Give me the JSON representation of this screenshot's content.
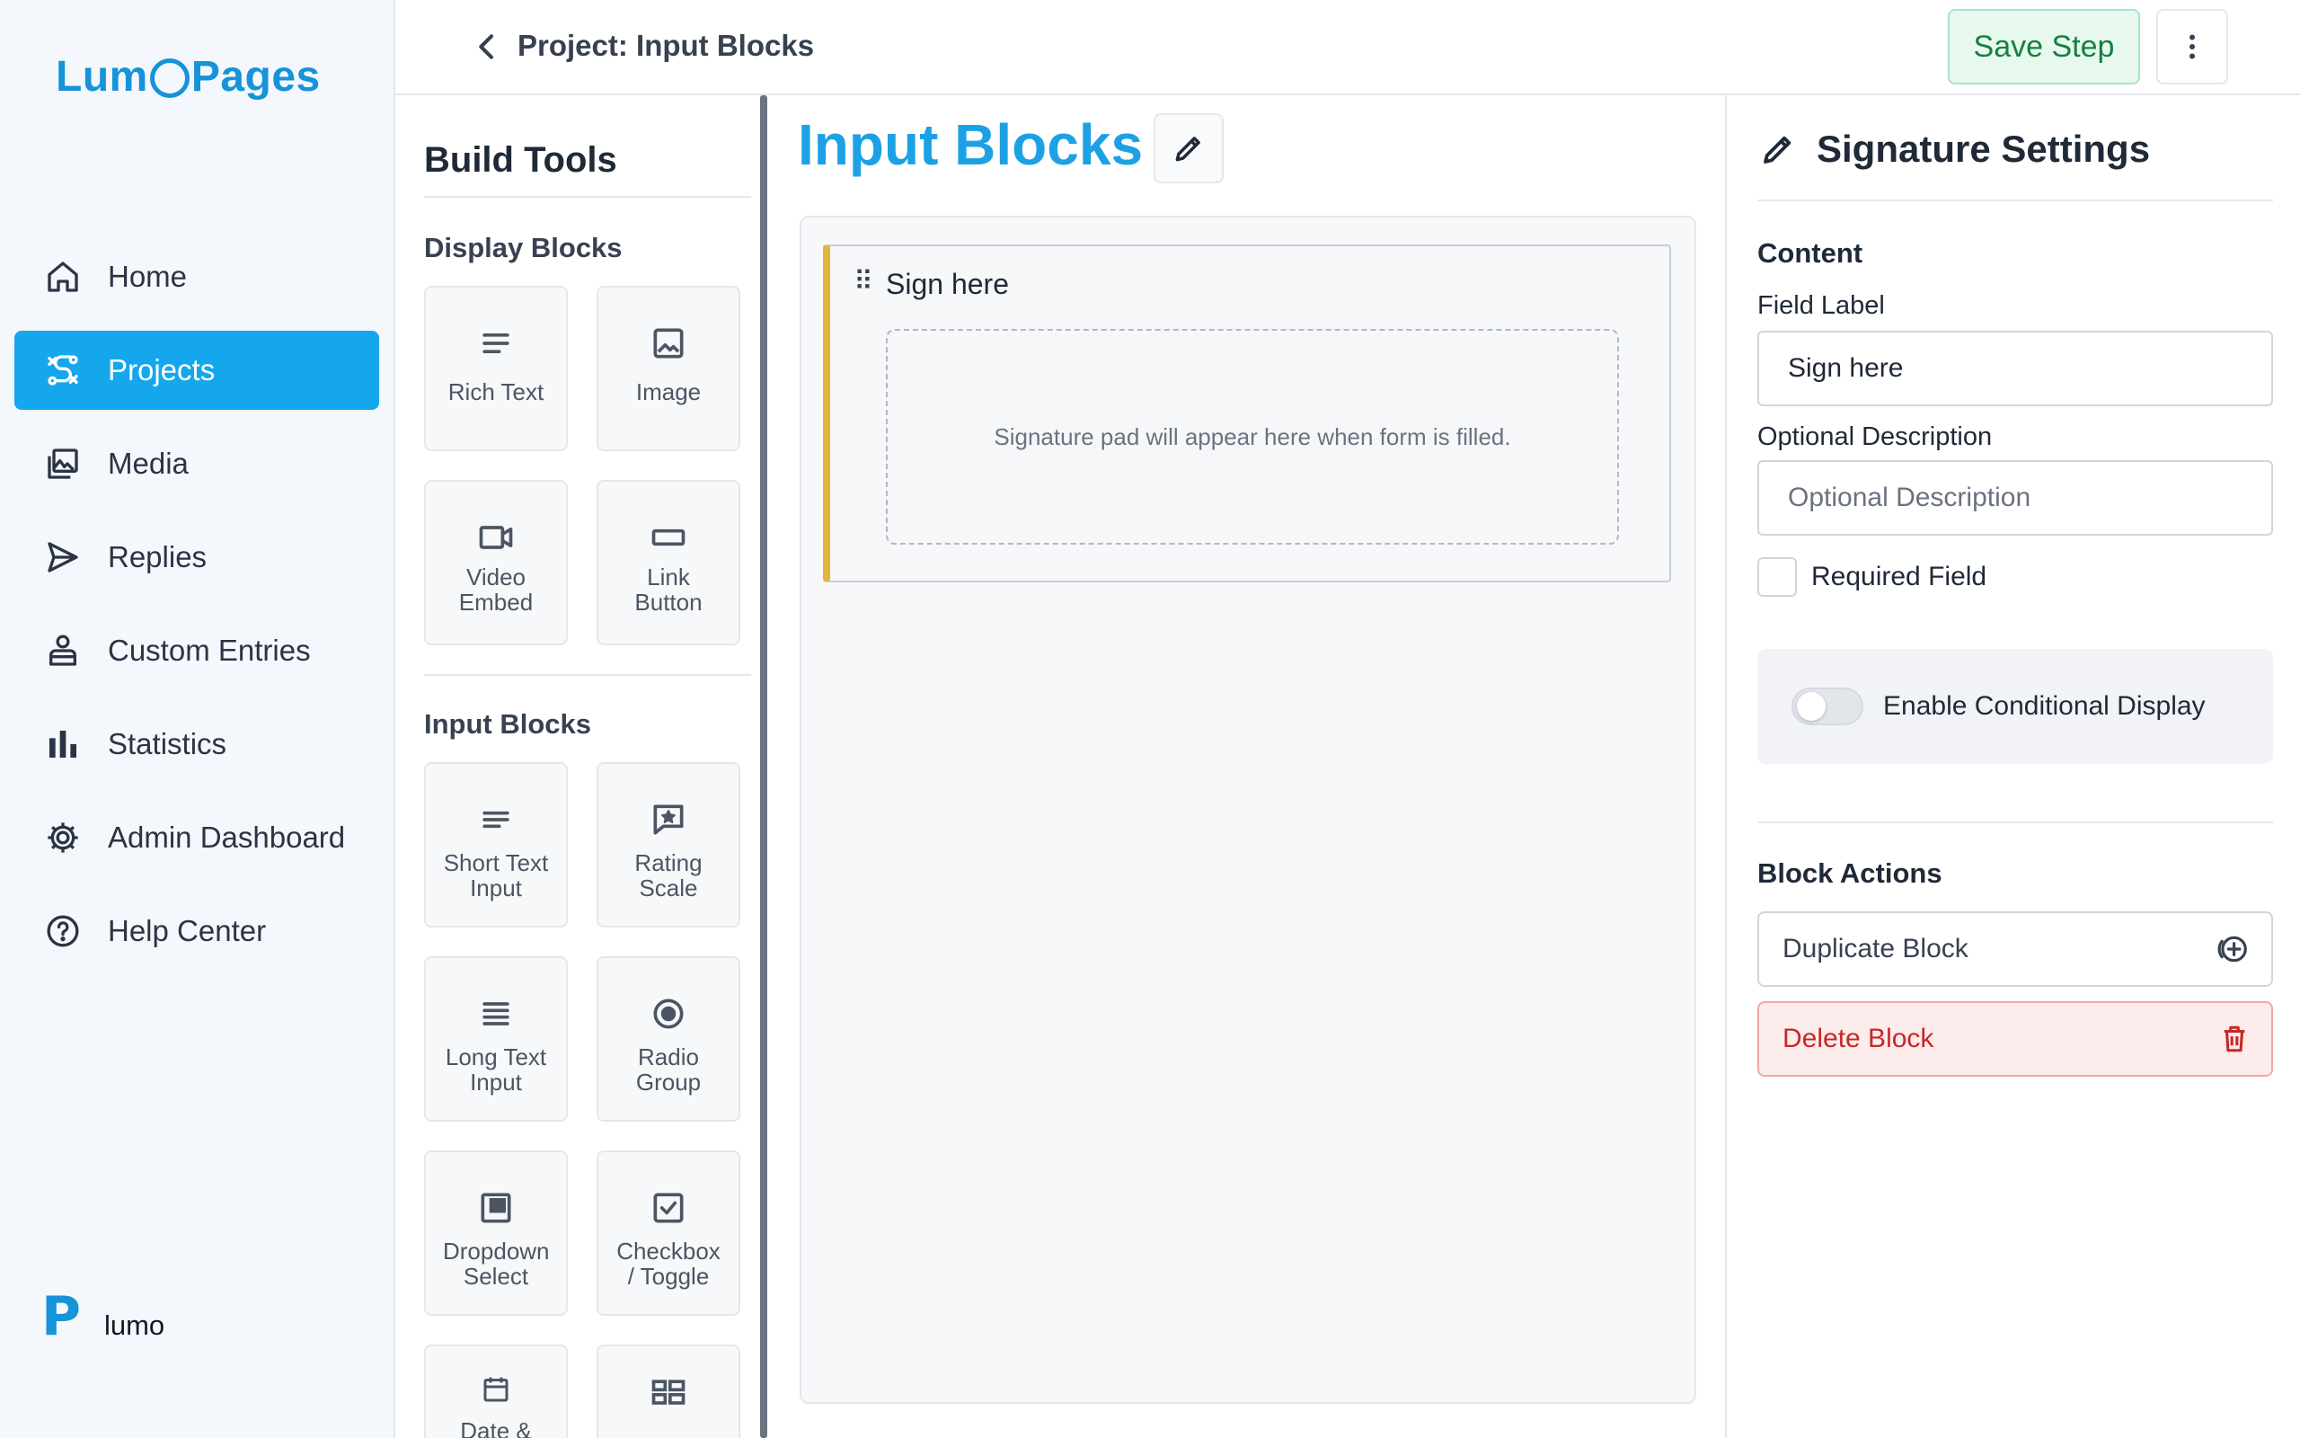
{
  "sidebar": {
    "logo": {
      "part1": "Lum",
      "part2": "Pages"
    },
    "items": [
      {
        "label": "Home",
        "icon": "home-icon",
        "active": false
      },
      {
        "label": "Projects",
        "icon": "projects-icon",
        "active": true
      },
      {
        "label": "Media",
        "icon": "media-icon",
        "active": false
      },
      {
        "label": "Replies",
        "icon": "send-icon",
        "active": false
      },
      {
        "label": "Custom Entries",
        "icon": "user-entries-icon",
        "active": false
      },
      {
        "label": "Statistics",
        "icon": "bar-chart-icon",
        "active": false
      },
      {
        "label": "Admin Dashboard",
        "icon": "gear-icon",
        "active": false
      },
      {
        "label": "Help Center",
        "icon": "help-icon",
        "active": false
      }
    ],
    "footer": {
      "mark": "P",
      "brand": "lumo"
    }
  },
  "topbar": {
    "breadcrumb": "Project: Input Blocks",
    "save_label": "Save Step"
  },
  "tools": {
    "title": "Build Tools",
    "display_title": "Display Blocks",
    "display_blocks": [
      {
        "label": "Rich Text",
        "icon": "text-lines-icon"
      },
      {
        "label": "Image",
        "icon": "image-icon"
      },
      {
        "label": "Video Embed",
        "icon": "video-icon"
      },
      {
        "label": "Link Button",
        "icon": "button-icon"
      }
    ],
    "input_title": "Input Blocks",
    "input_blocks": [
      {
        "label": "Short Text Input",
        "icon": "short-text-icon"
      },
      {
        "label": "Rating Scale",
        "icon": "rating-icon"
      },
      {
        "label": "Long Text Input",
        "icon": "long-text-icon"
      },
      {
        "label": "Radio Group",
        "icon": "radio-icon"
      },
      {
        "label": "Dropdown Select",
        "icon": "dropdown-icon"
      },
      {
        "label": "Checkbox / Toggle",
        "icon": "checkbox-icon"
      },
      {
        "label": "Date &",
        "icon": "calendar-icon"
      },
      {
        "label": "",
        "icon": "grid-icon"
      }
    ]
  },
  "canvas": {
    "title": "Input Blocks",
    "block": {
      "label": "Sign here",
      "pad_text": "Signature pad will appear here when form is filled.",
      "accent": "#e4b53c"
    }
  },
  "settings": {
    "title": "Signature Settings",
    "content_title": "Content",
    "field_label_label": "Field Label",
    "field_label_value": "Sign here",
    "desc_label": "Optional Description",
    "desc_placeholder": "Optional Description",
    "required_label": "Required Field",
    "conditional_label": "Enable Conditional Display",
    "actions_title": "Block Actions",
    "duplicate_label": "Duplicate Block",
    "delete_label": "Delete Block"
  },
  "colors": {
    "primary": "#15a7ec",
    "save_green": "#15803d",
    "delete_red": "#c62828"
  }
}
